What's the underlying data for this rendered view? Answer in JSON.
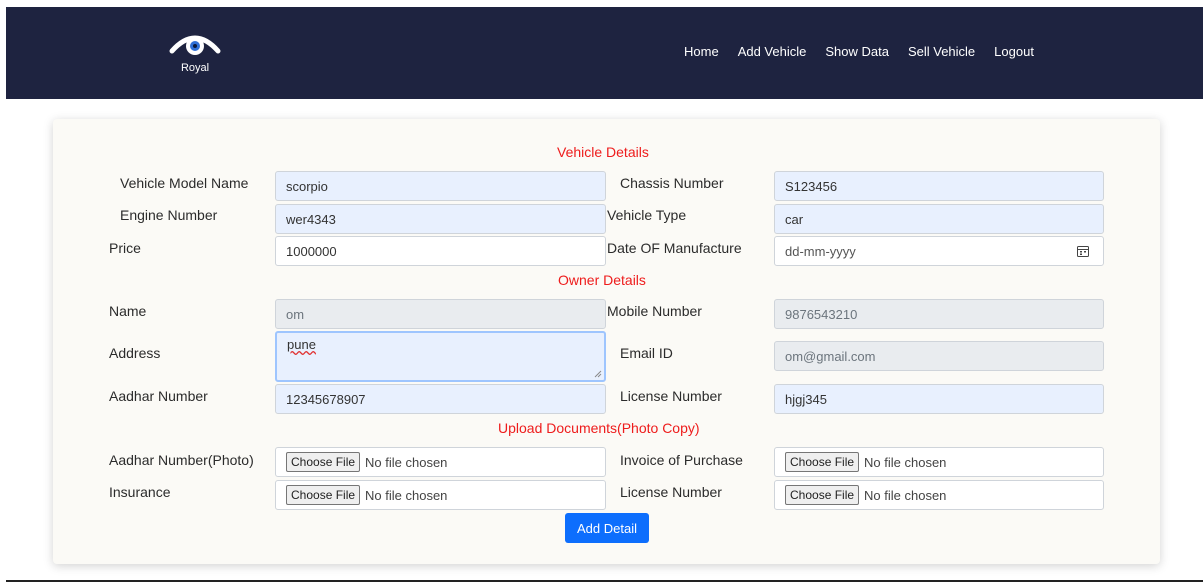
{
  "brand": {
    "logo_text": "Royal"
  },
  "nav": [
    "Home",
    "Add Vehicle",
    "Show Data",
    "Sell Vehicle",
    "Logout"
  ],
  "sections": {
    "vehicle": "Vehicle Details",
    "owner": "Owner Details",
    "upload": "Upload Documents(Photo Copy)"
  },
  "vehicle": {
    "model_label": "Vehicle Model Name",
    "model_value": "scorpio",
    "chassis_label": "Chassis Number",
    "chassis_value": "S123456",
    "engine_label": "Engine Number",
    "engine_value": "wer4343",
    "type_label": "Vehicle Type",
    "type_value": "car",
    "price_label": "Price",
    "price_value": "1000000",
    "dom_label": "Date OF Manufacture",
    "dom_placeholder": "dd-mm-yyyy"
  },
  "owner": {
    "name_label": "Name",
    "name_value": "om",
    "mobile_label": "Mobile Number",
    "mobile_value": "9876543210",
    "address_label": "Address",
    "address_value": "pune",
    "email_label": "Email ID",
    "email_value": "om@gmail.com",
    "aadhar_label": "Aadhar Number",
    "aadhar_value": "12345678907",
    "license_label": "License Number",
    "license_value": "hjgj345"
  },
  "uploads": {
    "aadhar_photo_label": "Aadhar Number(Photo)",
    "invoice_label": "Invoice of Purchase",
    "insurance_label": "Insurance",
    "license_label": "License Number",
    "choose_label": "Choose File",
    "no_file": "No file chosen"
  },
  "submit_label": "Add Detail",
  "colors": {
    "navbar": "#1e2340",
    "section_title": "#ee1c1c",
    "button": "#0d6efd"
  }
}
